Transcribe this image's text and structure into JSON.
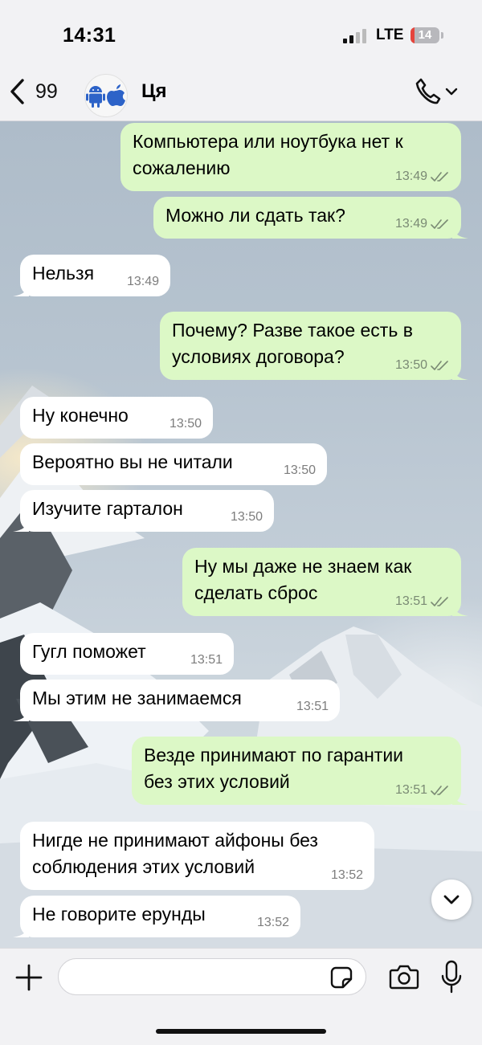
{
  "status_bar": {
    "time": "14:31",
    "network": "LTE",
    "battery_level": "14",
    "battery_color": "#e5453d"
  },
  "nav": {
    "back_count": "99",
    "title": "Ця",
    "back_icon": "chevron-left-icon",
    "call_icon": "phone-icon"
  },
  "colors": {
    "incoming_bubble": "#ffffff",
    "outgoing_bubble": "#dcf8c6",
    "read_ticks": "#7a8a74"
  },
  "messages": [
    {
      "dir": "out",
      "text": "Компьютера или ноутбука нет к\nсожалению",
      "time": "13:49",
      "read": true
    },
    {
      "dir": "out",
      "text": "Можно ли сдать так?",
      "time": "13:49",
      "read": true
    },
    {
      "dir": "in",
      "text": "Нельзя",
      "time": "13:49"
    },
    {
      "dir": "out",
      "text": "Почему? Разве такое есть в\nусловиях договора?",
      "time": "13:50",
      "read": true
    },
    {
      "dir": "in",
      "text": "Ну конечно",
      "time": "13:50"
    },
    {
      "dir": "in",
      "text": "Вероятно вы не читали",
      "time": "13:50"
    },
    {
      "dir": "in",
      "text": "Изучите гарталон",
      "time": "13:50"
    },
    {
      "dir": "out",
      "text": "Ну мы даже не знаем как\nсделать сброс",
      "time": "13:51",
      "read": true
    },
    {
      "dir": "in",
      "text": "Гугл поможет",
      "time": "13:51"
    },
    {
      "dir": "in",
      "text": "Мы этим не занимаемся",
      "time": "13:51"
    },
    {
      "dir": "out",
      "text": "Везде принимают по гарантии\nбез этих условий",
      "time": "13:51",
      "read": true
    },
    {
      "dir": "in",
      "text": "Нигде не принимают айфоны без\nсоблюдения этих условий",
      "time": "13:52"
    },
    {
      "dir": "in",
      "text": "Не говорите ерунды",
      "time": "13:52"
    }
  ],
  "input": {
    "value": "",
    "placeholder": ""
  }
}
